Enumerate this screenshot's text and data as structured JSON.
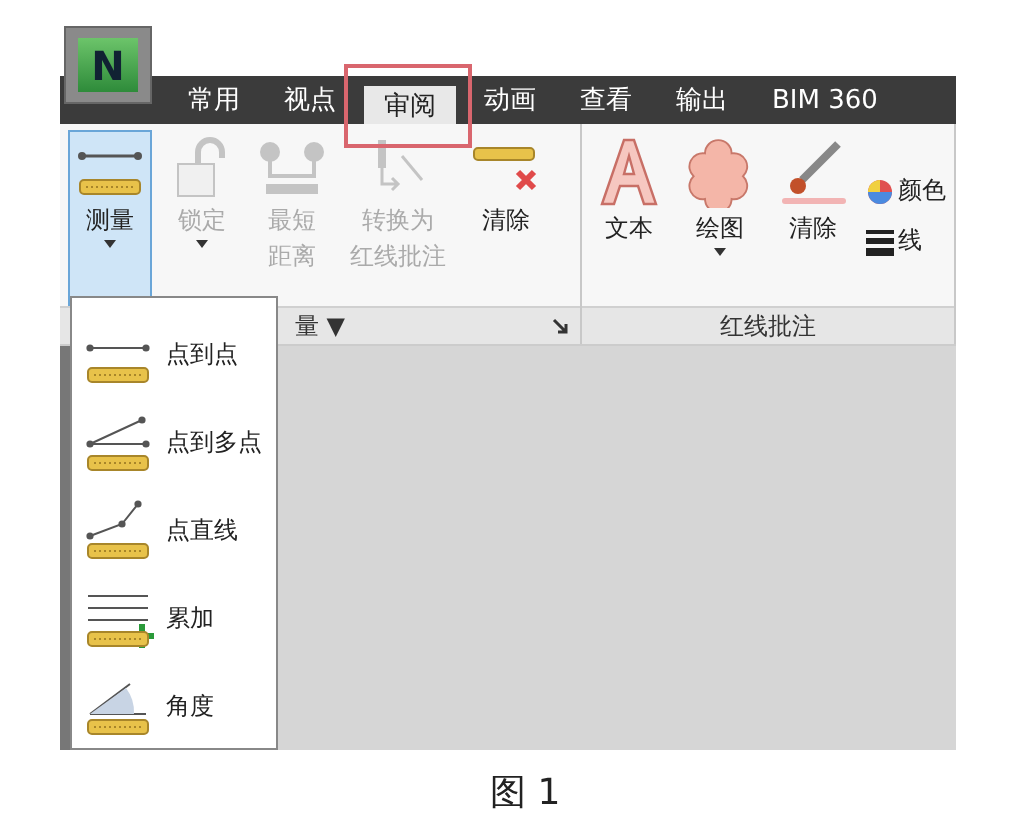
{
  "logo": {
    "text": "N"
  },
  "tabs": [
    {
      "label": "常用",
      "selected": false
    },
    {
      "label": "视点",
      "selected": false
    },
    {
      "label": "审阅",
      "selected": true
    },
    {
      "label": "动画",
      "selected": false
    },
    {
      "label": "查看",
      "selected": false
    },
    {
      "label": "输出",
      "selected": false
    },
    {
      "label": "BIM 360",
      "selected": false
    }
  ],
  "ribbon": {
    "groups": [
      {
        "label": "量 ▼",
        "launcher": true,
        "buttons": [
          {
            "kind": "measure",
            "lines": [
              "测量"
            ],
            "selected": true,
            "disabled": false,
            "dropdown": true
          },
          {
            "kind": "lock",
            "lines": [
              "锁定"
            ],
            "selected": false,
            "disabled": true,
            "dropdown": true
          },
          {
            "kind": "shortest",
            "lines": [
              "最短",
              "距离"
            ],
            "selected": false,
            "disabled": true,
            "dropdown": false
          },
          {
            "kind": "convert",
            "lines": [
              "转换为",
              "红线批注"
            ],
            "selected": false,
            "disabled": true,
            "dropdown": false
          },
          {
            "kind": "clear-measure",
            "lines": [
              "清除"
            ],
            "selected": false,
            "disabled": false,
            "dropdown": false
          }
        ]
      },
      {
        "label": "红线批注",
        "launcher": false,
        "buttons": [
          {
            "kind": "text",
            "lines": [
              "文本"
            ],
            "selected": false,
            "disabled": false,
            "dropdown": false
          },
          {
            "kind": "draw",
            "lines": [
              "绘图"
            ],
            "selected": false,
            "disabled": false,
            "dropdown": true
          },
          {
            "kind": "erase",
            "lines": [
              "清除"
            ],
            "selected": false,
            "disabled": false,
            "dropdown": false
          }
        ],
        "small_buttons": [
          {
            "kind": "color",
            "label": "颜色"
          },
          {
            "kind": "width",
            "label": "线"
          }
        ]
      }
    ]
  },
  "dropdown": {
    "items": [
      {
        "kind": "point-to-point",
        "label": "点到点"
      },
      {
        "kind": "point-to-multi",
        "label": "点到多点"
      },
      {
        "kind": "polyline",
        "label": "点直线"
      },
      {
        "kind": "accumulate",
        "label": "累加"
      },
      {
        "kind": "angle",
        "label": "角度"
      }
    ]
  },
  "caption": "图 1"
}
